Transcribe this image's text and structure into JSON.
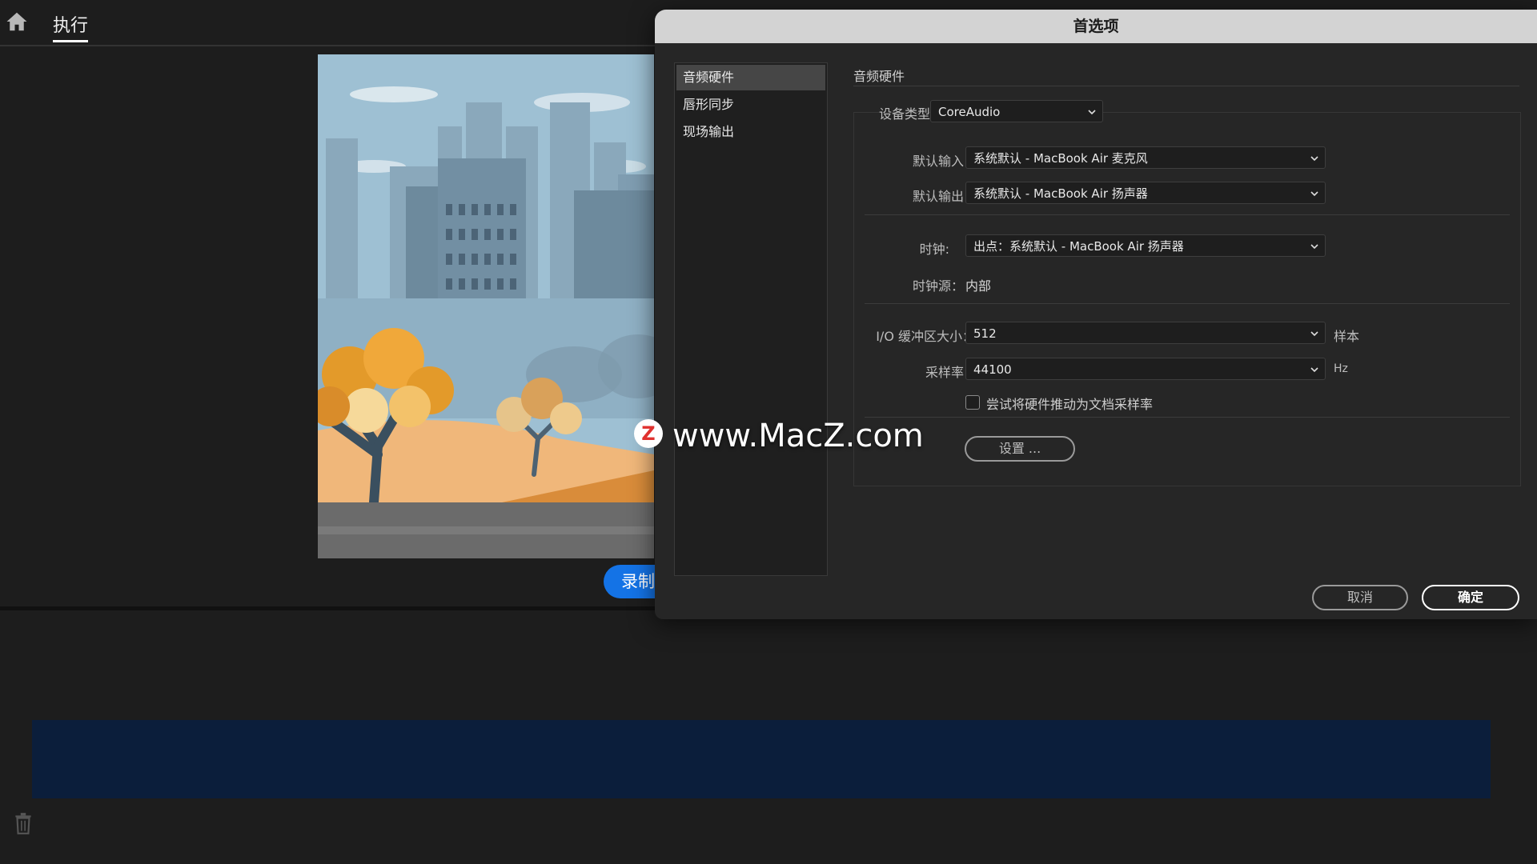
{
  "topbar": {
    "home_icon": "home-icon",
    "tab_label": "执行"
  },
  "stage": {
    "record_label": "录制"
  },
  "watermark": {
    "logo_letter": "Z",
    "text": "www.MacZ.com"
  },
  "dialog": {
    "title": "首选项",
    "sidebar": [
      {
        "label": "音频硬件",
        "selected": true
      },
      {
        "label": "唇形同步",
        "selected": false
      },
      {
        "label": "现场输出",
        "selected": false
      }
    ],
    "section_title": "音频硬件",
    "device_type": {
      "label": "设备类型：",
      "value": "CoreAudio"
    },
    "default_input": {
      "label": "默认输入：",
      "value": "系统默认 - MacBook Air 麦克风"
    },
    "default_output": {
      "label": "默认输出：",
      "value": "系统默认 - MacBook Air 扬声器"
    },
    "clock": {
      "label": "时钟:",
      "value": "出点：系统默认 - MacBook Air 扬声器"
    },
    "clock_source": {
      "label": "时钟源：",
      "value": "内部"
    },
    "buffer": {
      "label": "I/O 缓冲区大小：",
      "value": "512",
      "unit": "样本"
    },
    "sample_rate": {
      "label": "采样率：",
      "value": "44100",
      "unit": "Hz"
    },
    "checkbox": {
      "label": "尝试将硬件推动为文档采样率",
      "checked": false
    },
    "settings_button": "设置 ...",
    "cancel_button": "取消",
    "ok_button": "确定"
  },
  "colors": {
    "record_blue": "#1473e6",
    "timeline_navy": "#0b1e3b",
    "dialog_bg": "#262626",
    "title_bar": "#d3d3d3"
  }
}
